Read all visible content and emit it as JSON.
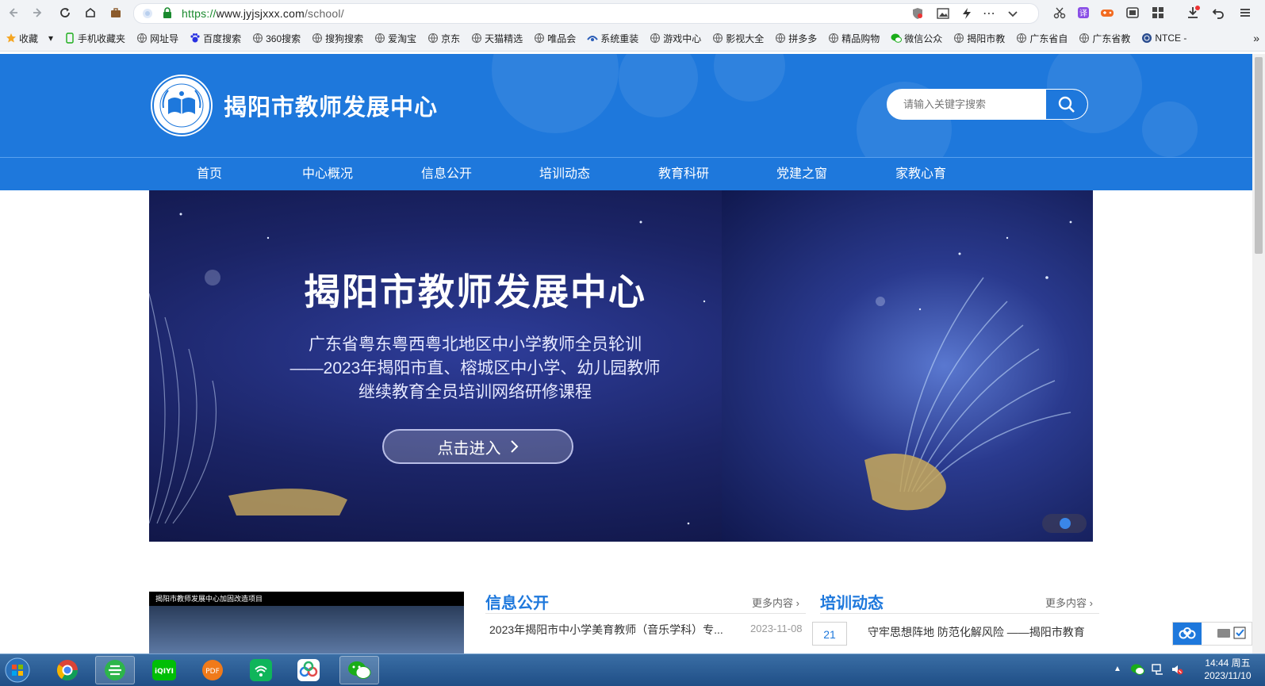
{
  "browser": {
    "url_scheme": "https://",
    "url_host": "www.jyjsjxxx.com",
    "url_path": "/school/",
    "bookmarks": [
      {
        "label": "收藏",
        "icon": "star-icon"
      },
      {
        "label": "手机收藏夹",
        "icon": "phone-icon"
      },
      {
        "label": "网址导",
        "icon": "globe-icon"
      },
      {
        "label": "百度搜索",
        "icon": "baidu-icon"
      },
      {
        "label": "360搜索",
        "icon": "globe-icon"
      },
      {
        "label": "搜狗搜索",
        "icon": "globe-icon"
      },
      {
        "label": "爱淘宝",
        "icon": "globe-icon"
      },
      {
        "label": "京东",
        "icon": "globe-icon"
      },
      {
        "label": "天猫精选",
        "icon": "globe-icon"
      },
      {
        "label": "唯品会",
        "icon": "globe-icon"
      },
      {
        "label": "系统重装",
        "icon": "system-icon"
      },
      {
        "label": "游戏中心",
        "icon": "globe-icon"
      },
      {
        "label": "影视大全",
        "icon": "globe-icon"
      },
      {
        "label": "拼多多",
        "icon": "globe-icon"
      },
      {
        "label": "精品购物",
        "icon": "globe-icon"
      },
      {
        "label": "微信公众",
        "icon": "wechat-icon"
      },
      {
        "label": "揭阳市教",
        "icon": "globe-icon"
      },
      {
        "label": "广东省自",
        "icon": "globe-icon"
      },
      {
        "label": "广东省教",
        "icon": "globe-icon"
      },
      {
        "label": "NTCE -",
        "icon": "ntce-icon"
      }
    ],
    "overflow_label": "»"
  },
  "site": {
    "title": "揭阳市教师发展中心",
    "search_placeholder": "请输入关键字搜索",
    "nav": [
      "首页",
      "中心概况",
      "信息公开",
      "培训动态",
      "教育科研",
      "党建之窗",
      "家教心育"
    ],
    "banner": {
      "title": "揭阳市教师发展中心",
      "lines": [
        "广东省粤东粤西粤北地区中小学教师全员轮训",
        "——2023年揭阳市直、榕城区中小学、幼儿园教师",
        "继续教育全员培训网络研修课程"
      ],
      "button": "点击进入"
    },
    "news_image_caption": "揭阳市教师发展中心加固改造项目",
    "info_section": {
      "title": "信息公开",
      "more": "更多内容",
      "items": [
        {
          "text": "2023年揭阳市中小学美育教师（音乐学科）专...",
          "date": "2023-11-08"
        }
      ]
    },
    "training_section": {
      "title": "培训动态",
      "more": "更多内容",
      "items": [
        {
          "day": "21",
          "text": "守牢思想阵地 防范化解风险 ——揭阳市教育"
        }
      ]
    }
  },
  "taskbar": {
    "time": "14:44 周五",
    "date": "2023/11/10"
  },
  "colors": {
    "brand_blue": "#1e78dc",
    "taskbar": "#2a5d96"
  }
}
